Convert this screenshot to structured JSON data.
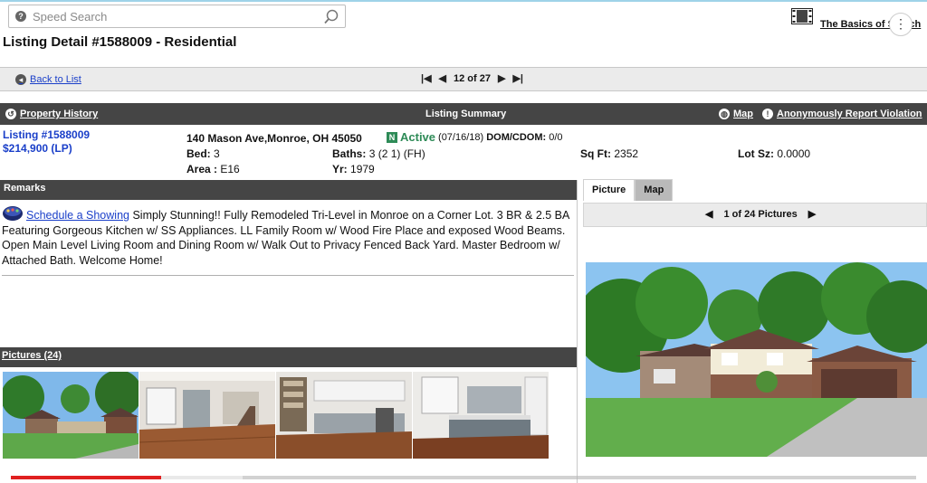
{
  "search": {
    "placeholder": "Speed Search"
  },
  "video_link": {
    "label": "The Basics of Search"
  },
  "page_title": "Listing Detail #1588009 - Residential",
  "nav": {
    "back_label": "Back to List",
    "position": "12 of 27"
  },
  "summary_bar": {
    "property_history": "Property History",
    "title": "Listing Summary",
    "map": "Map",
    "report": "Anonymously Report Violation"
  },
  "listing": {
    "number": "Listing #1588009",
    "price": "$214,900 (LP)",
    "address": "140 Mason Ave,Monroe, OH  45050",
    "status_badge": "N",
    "status": "Active",
    "status_date": "(07/16/18)",
    "dom_label": "DOM/CDOM:",
    "dom_value": "0/0",
    "bed_label": "Bed:",
    "bed_value": "3",
    "baths_label": "Baths:",
    "baths_value": "3 (2 1) (FH)",
    "sqft_label": "Sq Ft:",
    "sqft_value": "2352",
    "lot_label": "Lot Sz:",
    "lot_value": "0.0000",
    "area_label": "Area :",
    "area_value": "E16",
    "yr_label": "Yr:",
    "yr_value": "1979"
  },
  "remarks": {
    "header": "Remarks",
    "schedule_link": "Schedule a Showing",
    "text": "Simply Stunning!! Fully Remodeled Tri-Level in Monroe on a Corner Lot. 3 BR & 2.5 BA Featuring Gorgeous Kitchen w/ SS Appliances. LL Family Room w/ Wood Fire Place and exposed Wood Beams. Open Main Level Living Room and Dining Room w/ Walk Out to Privacy Fenced Back Yard. Master Bedroom w/ Attached Bath. Welcome Home!"
  },
  "pictures": {
    "header": "Pictures (24)"
  },
  "photo_panel": {
    "tab_picture": "Picture",
    "tab_map": "Map",
    "counter": "1 of 24 Pictures"
  },
  "icons": {
    "search": "help-circle-icon",
    "magnifier": "magnifier-icon",
    "video": "film-icon",
    "history": "history-icon",
    "map": "globe-icon",
    "report": "info-icon"
  },
  "video_progress": {
    "played_fraction": 0.166
  },
  "colors": {
    "dark_bar": "#454545",
    "link": "#1a3fc9",
    "active": "#2e8b57"
  }
}
